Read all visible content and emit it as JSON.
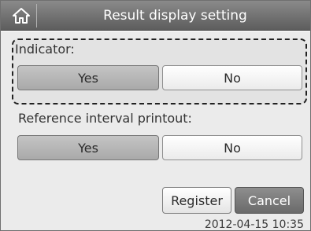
{
  "header": {
    "home_icon": "home-icon",
    "title": "Result display setting"
  },
  "indicator": {
    "label": "Indicator:",
    "yes_label": "Yes",
    "no_label": "No",
    "selected": "Yes"
  },
  "reference_interval": {
    "label": "Reference interval printout:",
    "yes_label": "Yes",
    "no_label": "No",
    "selected": "Yes"
  },
  "actions": {
    "register_label": "Register",
    "cancel_label": "Cancel"
  },
  "status": {
    "datetime": "2012-04-15 10:35"
  }
}
